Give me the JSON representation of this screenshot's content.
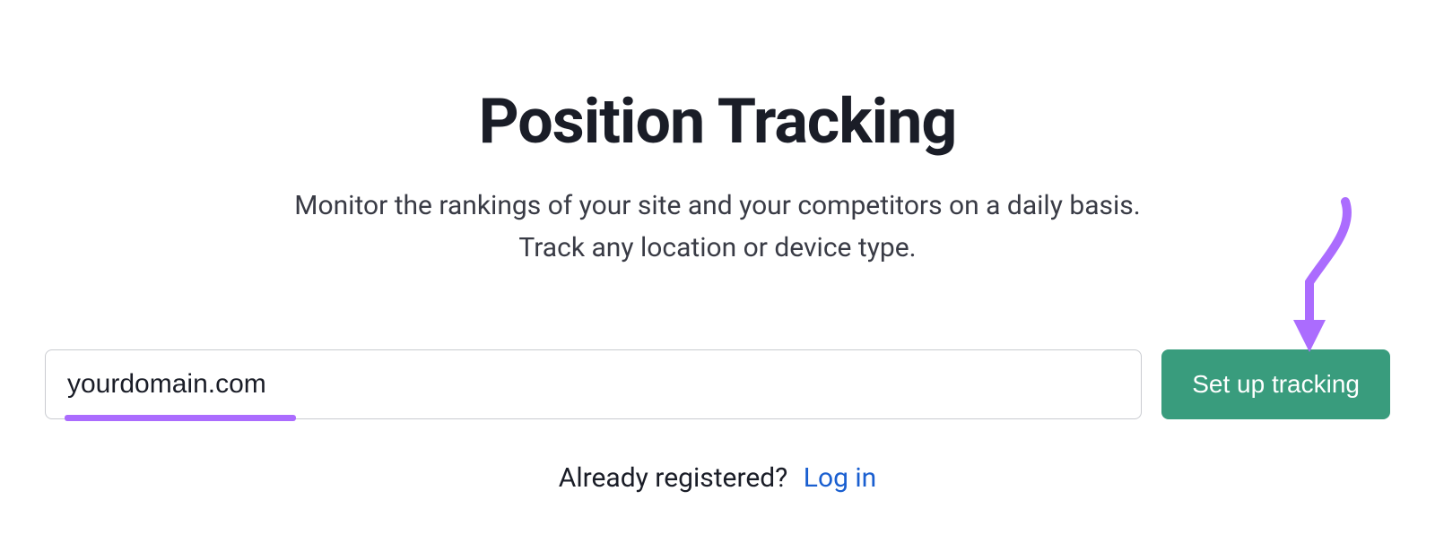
{
  "header": {
    "title": "Position Tracking",
    "subtitle_line1": "Monitor the rankings of your site and your competitors on a daily basis.",
    "subtitle_line2": "Track any location or device type."
  },
  "form": {
    "domain_value": "yourdomain.com",
    "submit_label": "Set up tracking"
  },
  "login": {
    "prompt": "Already registered?",
    "link_label": "Log in"
  },
  "annotation": {
    "arrow_color": "#ab6cfe"
  }
}
